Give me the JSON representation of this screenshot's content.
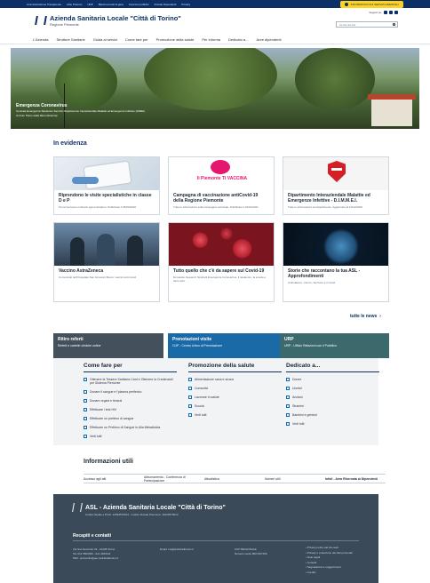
{
  "topbar": {
    "links": [
      "Amministrazione Trasparente",
      "Albo Pretorio",
      "URP",
      "Bandi ed esiti di gara",
      "Concorsi pubblici",
      "Portale Dipendenti",
      "Privacy"
    ],
    "notice": "INFORMATIVA SUI SERVIZI AZIENDALI"
  },
  "header": {
    "name": "Azienda Sanitaria Locale \"Città di Torino\"",
    "region": "Regione Piemonte",
    "social_label": "Seguici su:",
    "search_placeholder": "Cerca nel sito"
  },
  "nav": [
    "L'Azienda",
    "Strutture Sanitarie",
    "Guida ai servizi",
    "Come fare per",
    "Promozione della salute",
    "Per informa",
    "Dedicato a...",
    "Aree dipendenti"
  ],
  "hero": {
    "title": "Emergenza Coronavirus",
    "desc": "Centrale Emergenza Telefonico Servizio Dipartimento Interaziendale Malattie ed Emergenze Infettive (DIMEI)",
    "caption": "(In foto: Parco della Rimembranza)"
  },
  "evidenza": {
    "title": "In evidenza",
    "cards": [
      {
        "title": "Riprendono le visite specialistiche in classe D e P",
        "desc": "Torna l'accesso ordinario agli ambulatori. Pubblicato il 05/06/2020"
      },
      {
        "title": "Campagna di vaccinazione antiCovid-19 della Regione Piemonte",
        "desc": "Tutte le informazioni sulla campagna vaccinale. Pubblicato il 19/01/2021"
      },
      {
        "title": "Dipartimento Interaziendale Malattie ed Emergenze Infettive - D.I.M.M.E.I.",
        "desc": "Tutte le informazioni sul dipartimento. Aggiornato al 10/12/2020"
      },
      {
        "title": "Vaccino AstraZeneca",
        "desc": "Comunicati dell'Ospedale San Giovanni Bosco: vaccini anti-Covid"
      },
      {
        "title": "Tutto quello che c'è da sapere sul Covid-19",
        "desc": "Domande frequenti: Sportelli Emergenza Coronavirus, il telelavoro, la scuola e tanto altro"
      },
      {
        "title": "Storie che raccontano la tua ASL - Approfondimenti",
        "desc": "Ambulatorio, Centro, Territorio e il Covid"
      }
    ],
    "banner_text": "Il Piemonte TI VACCINA",
    "more": "tutte le news"
  },
  "quick": [
    {
      "title": "Ritiro referti",
      "desc": "Referti e cartelle cliniche online",
      "color": "#44505c"
    },
    {
      "title": "Prenotazioni visite",
      "desc": "CUP - Centro Unico di Prenotazione",
      "color": "#1b6aa8"
    },
    {
      "title": "URP",
      "desc": "URP - Ufficio Relazioni con il Pubblico",
      "color": "#3c6a6c"
    }
  ],
  "columns": [
    {
      "title": "Come fare per",
      "items": [
        "Ottenere la Tessera Sanitaria Card e Ottenere la Credenziali per Sistema Piemonte",
        "Donare il sangue e l'plasma periferico",
        "Donare organi e tessuti",
        "Effettuare i test HIV",
        "Effettuare un prelievo di sangue",
        "Effettuare un Prelievo di Sangue in Alla Metadistica",
        "Vedi tutti"
      ]
    },
    {
      "title": "Promozione della salute",
      "items": [
        "Alimentazione sana e sicura",
        "Comunità",
        "Lavorare in salute",
        "Scuola",
        "Vedi tutti"
      ]
    },
    {
      "title": "Dedicato a...",
      "items": [
        "Donne",
        "Uomini",
        "Anziani",
        "Stranieri",
        "Bambini e genitori",
        "Vedi tutti"
      ]
    }
  ],
  "info": {
    "title": "Informazioni utili",
    "items": [
      "Accesso agli atti",
      "Abbonamento - Conferenza di Partecipazione",
      "Attualistica",
      "Numeri utili",
      "Infoli - Area Riservata ai Dipendenti"
    ]
  },
  "footer": {
    "title": "ASL - Azienda Sanitaria Locale \"Città di Torino\"",
    "sub": "Codice fiscale e P.IVA: 11632570013 - Codice Fiscale Piemonte: 11632570013",
    "recapiti": "Recapiti e contatti",
    "c1": [
      "Via San Secondo 29 - 10128 Torino",
      "Tel: 011 5661566 - 011 4393111",
      "PEC: protocollo@pec.aslcittaditorino.it"
    ],
    "c2": [
      "Email: urp@aslcittaditorino.it"
    ],
    "c3": [
      "CUP REGIONALE",
      "Numero verde 800 000 500"
    ],
    "links": [
      "Privacy policy del sito web",
      "Privacy e protezione dei dati personali",
      "Note legali",
      "Contatti",
      "Segnalazioni e suggerimenti",
      "Credits"
    ]
  }
}
